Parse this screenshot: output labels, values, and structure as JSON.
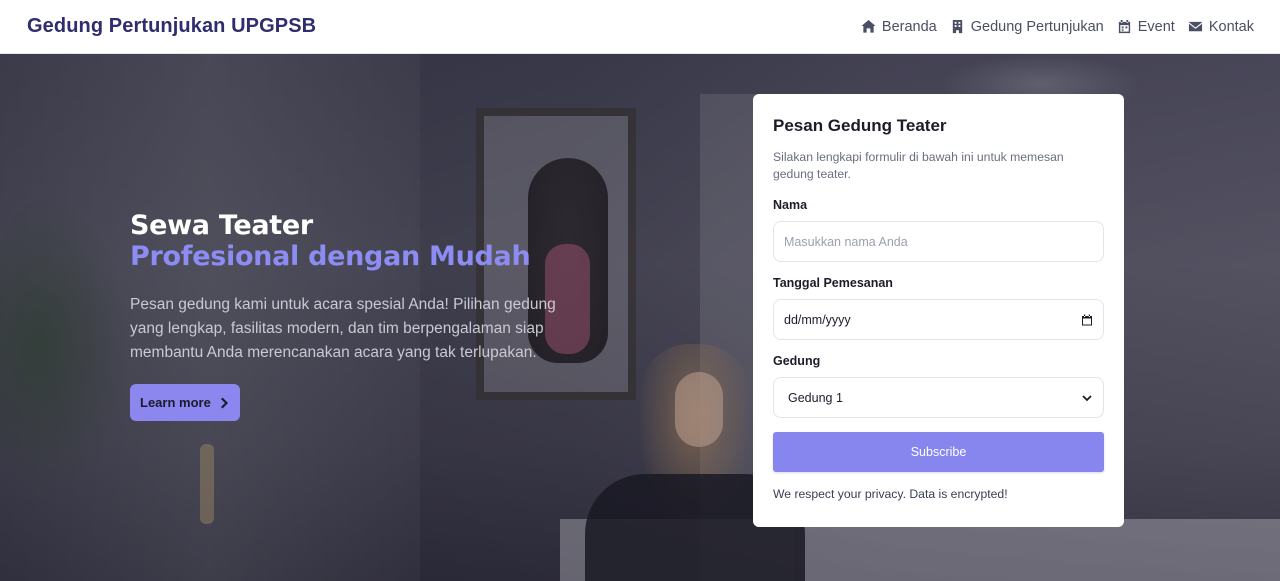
{
  "header": {
    "brand": "Gedung Pertunjukan UPGPSB",
    "nav": [
      {
        "label": "Beranda",
        "icon": "home-icon"
      },
      {
        "label": "Gedung Pertunjukan",
        "icon": "building-icon"
      },
      {
        "label": "Event",
        "icon": "calendar-icon"
      },
      {
        "label": "Kontak",
        "icon": "envelope-icon"
      }
    ]
  },
  "hero": {
    "title_line1": "Sewa Teater",
    "title_line2": "Profesional dengan Mudah",
    "description": "Pesan gedung kami untuk acara spesial Anda! Pilihan gedung yang lengkap, fasilitas modern, dan tim berpengalaman siap membantu Anda merencanakan acara yang tak terlupakan.",
    "cta_label": "Learn more",
    "cta_icon": "chevron-right-icon"
  },
  "form": {
    "title": "Pesan Gedung Teater",
    "description": "Silakan lengkapi formulir di bawah ini untuk memesan gedung teater.",
    "name_label": "Nama",
    "name_placeholder": "Masukkan nama Anda",
    "date_label": "Tanggal Pemesanan",
    "date_value": "dd/mm/yyyy",
    "date_icon": "calendar-picker-icon",
    "building_label": "Gedung",
    "building_selected": "Gedung 1",
    "building_icon": "chevron-down-icon",
    "submit_label": "Subscribe",
    "privacy_note": "We respect your privacy. Data is encrypted!"
  },
  "colors": {
    "brand": "#2f2d6e",
    "accent": "#8b87ee",
    "accent_text": "#8d8cf2"
  }
}
